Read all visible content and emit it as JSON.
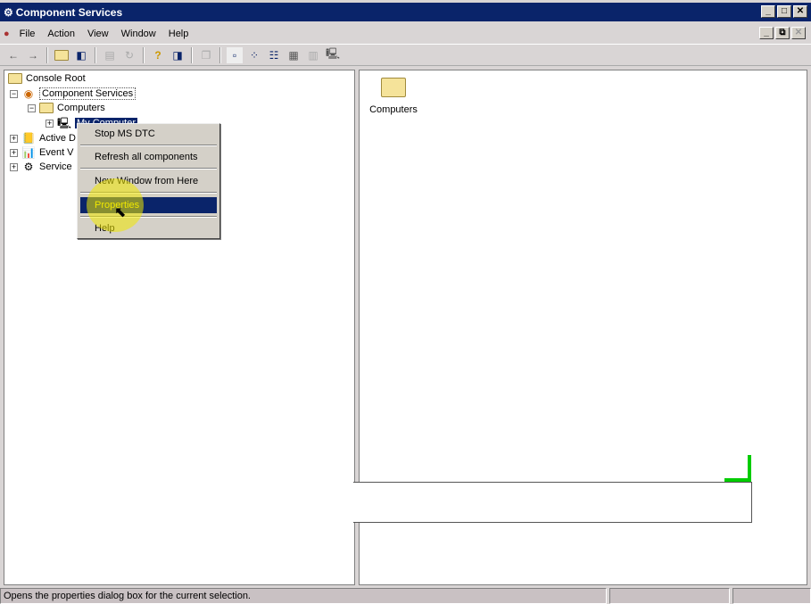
{
  "window": {
    "title": "Component Services",
    "minimize": "_",
    "maximize": "□",
    "close": "✕",
    "child_minimize": "_",
    "child_restore": "⧉",
    "child_close": "✕"
  },
  "menu": [
    "File",
    "Action",
    "View",
    "Window",
    "Help"
  ],
  "toolbar": {
    "icons": [
      "back-icon",
      "forward-icon",
      "up-folder-icon",
      "show-hide-tree-icon",
      "export-icon",
      "refresh-icon",
      "help-icon",
      "action-pane-icon",
      "new-window-icon",
      "large-icons-icon",
      "small-icons-icon",
      "list-icon",
      "detail-icon",
      "tile-icon",
      "computer-icon"
    ]
  },
  "tree": {
    "root": "Console Root",
    "component_services": "Component Services",
    "computers": "Computers",
    "my_computer": "My Computer",
    "active_directory": "Active D",
    "event_viewer": "Event V",
    "services": "Service"
  },
  "context_menu": {
    "items": [
      "Stop MS DTC",
      "Refresh all components",
      "New Window from Here",
      "Properties",
      "Help"
    ],
    "selected": "Properties"
  },
  "right_pane": {
    "items": [
      {
        "label": "Computers",
        "icon": "folder-icon"
      }
    ]
  },
  "status": {
    "text": "Opens the properties dialog box for the current selection."
  },
  "colors": {
    "titlebar": "#0a246a",
    "selection": "#0a246a",
    "highlight": "#f0e800",
    "green_marker": "#00cc00"
  }
}
